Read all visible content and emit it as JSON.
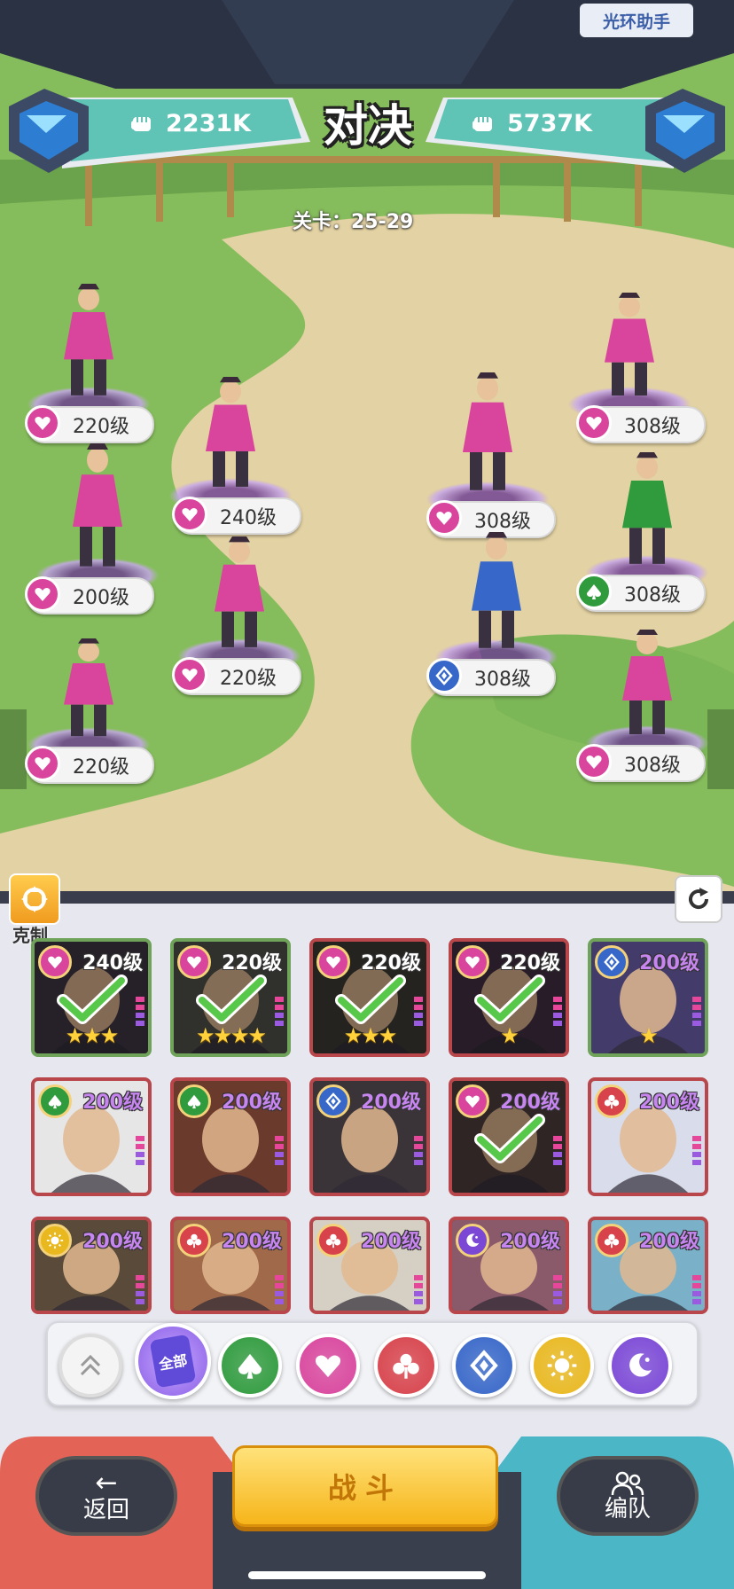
{
  "header": {
    "halo_helper_label": "光环助手",
    "title": "对决",
    "player_power": "2231K",
    "enemy_power": "5737K",
    "stage": "关卡：25-29"
  },
  "player_team": [
    {
      "level": "220级",
      "faction": "heart",
      "color": "#d9459d"
    },
    {
      "level": "240级",
      "faction": "heart",
      "color": "#d9459d"
    },
    {
      "level": "200级",
      "faction": "heart",
      "color": "#d9459d"
    },
    {
      "level": "220级",
      "faction": "heart",
      "color": "#d9459d"
    },
    {
      "level": "220级",
      "faction": "heart",
      "color": "#d9459d"
    }
  ],
  "enemy_team": [
    {
      "level": "308级",
      "faction": "heart",
      "color": "#d9459d"
    },
    {
      "level": "308级",
      "faction": "heart",
      "color": "#d9459d"
    },
    {
      "level": "308级",
      "faction": "spade",
      "color": "#2f9b3d"
    },
    {
      "level": "308级",
      "faction": "diamond",
      "color": "#3767c9"
    },
    {
      "level": "308级",
      "faction": "heart",
      "color": "#d9459d"
    }
  ],
  "panel": {
    "counter_label": "克制",
    "roster": [
      {
        "level": "240级",
        "faction": "heart",
        "stars": "★★★",
        "selected": true
      },
      {
        "level": "220级",
        "faction": "heart",
        "stars": "★★★★",
        "selected": true
      },
      {
        "level": "220级",
        "faction": "heart",
        "stars": "★★★",
        "selected": true
      },
      {
        "level": "220级",
        "faction": "heart",
        "stars": "★",
        "selected": true
      },
      {
        "level": "200级",
        "faction": "diamond",
        "stars": "★",
        "selected": false
      },
      {
        "level": "200级",
        "faction": "spade",
        "stars": "",
        "selected": false
      },
      {
        "level": "200级",
        "faction": "spade",
        "stars": "",
        "selected": false
      },
      {
        "level": "200级",
        "faction": "diamond",
        "stars": "",
        "selected": false
      },
      {
        "level": "200级",
        "faction": "heart",
        "stars": "",
        "selected": true
      },
      {
        "level": "200级",
        "faction": "club",
        "stars": "",
        "selected": false
      },
      {
        "level": "200级",
        "faction": "sun",
        "stars": "",
        "selected": false
      },
      {
        "level": "200级",
        "faction": "club",
        "stars": "",
        "selected": false
      },
      {
        "level": "200级",
        "faction": "club",
        "stars": "",
        "selected": false
      },
      {
        "level": "200级",
        "faction": "moon",
        "stars": "",
        "selected": false
      },
      {
        "level": "200级",
        "faction": "club",
        "stars": "",
        "selected": false
      }
    ],
    "filter_all_label": "全部",
    "filters": [
      {
        "name": "spade",
        "color": "#2f9b3d"
      },
      {
        "name": "heart",
        "color": "#d9459d"
      },
      {
        "name": "club",
        "color": "#d8424b"
      },
      {
        "name": "diamond",
        "color": "#3767c9"
      },
      {
        "name": "sun",
        "color": "#e9b81e"
      },
      {
        "name": "moon",
        "color": "#7b48d6"
      }
    ]
  },
  "footer": {
    "back_label": "返回",
    "fight_label": "战斗",
    "team_label": "编队"
  }
}
